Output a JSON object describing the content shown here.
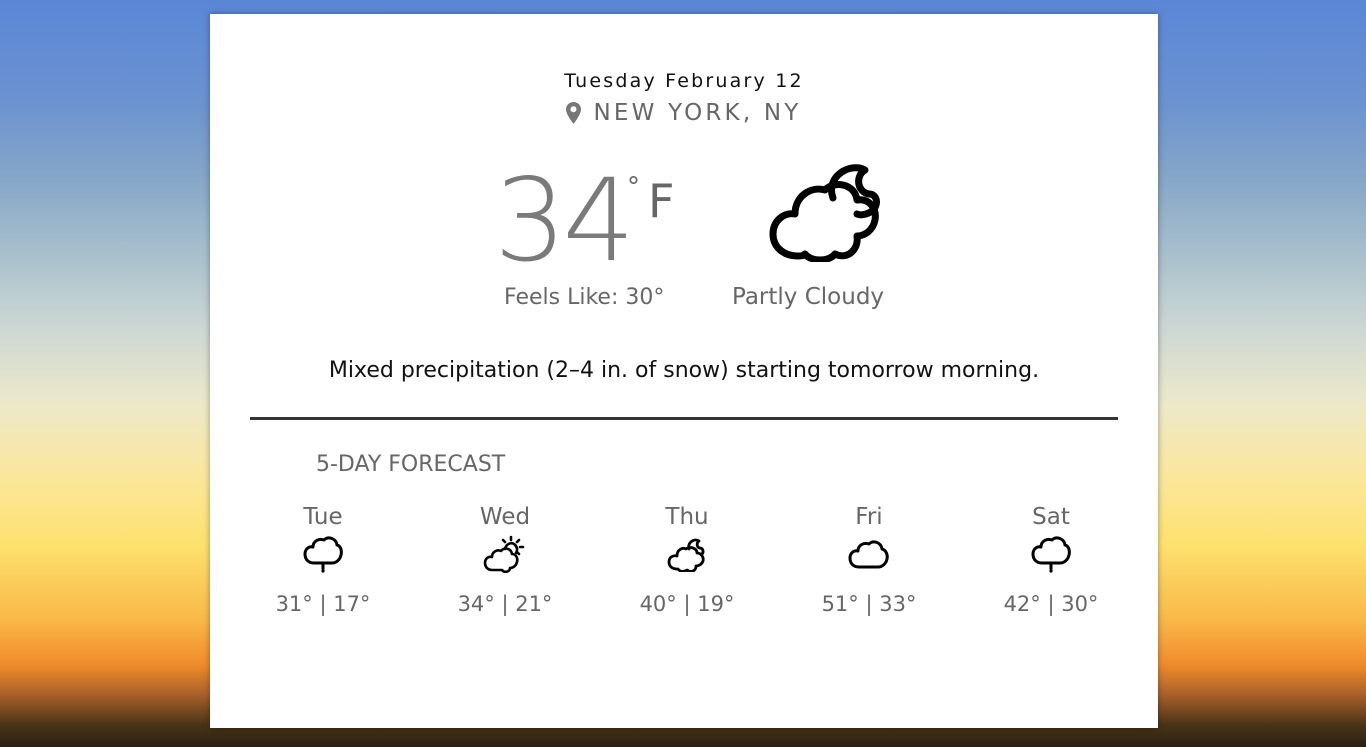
{
  "header": {
    "date": "Tuesday February 12",
    "location": "NEW YORK, NY",
    "location_icon": "map-pin-icon"
  },
  "current": {
    "temperature": "34",
    "degree_symbol": "°",
    "unit": "F",
    "feels_like": "Feels Like: 30°",
    "condition": "Partly Cloudy",
    "condition_icon": "cloud-moon-icon",
    "summary": "Mixed precipitation (2–4 in. of snow) starting tomorrow morning."
  },
  "forecast": {
    "title": "5-DAY FORECAST",
    "days": [
      {
        "day": "Tue",
        "icon": "cloud-drizzle-icon",
        "temps": "31° | 17°"
      },
      {
        "day": "Wed",
        "icon": "cloud-sun-icon",
        "temps": "34° | 21°"
      },
      {
        "day": "Thu",
        "icon": "cloud-moon-icon",
        "temps": "40° | 19°"
      },
      {
        "day": "Fri",
        "icon": "cloud-icon",
        "temps": "51° | 33°"
      },
      {
        "day": "Sat",
        "icon": "cloud-drizzle-icon",
        "temps": "42° | 30°"
      }
    ]
  }
}
